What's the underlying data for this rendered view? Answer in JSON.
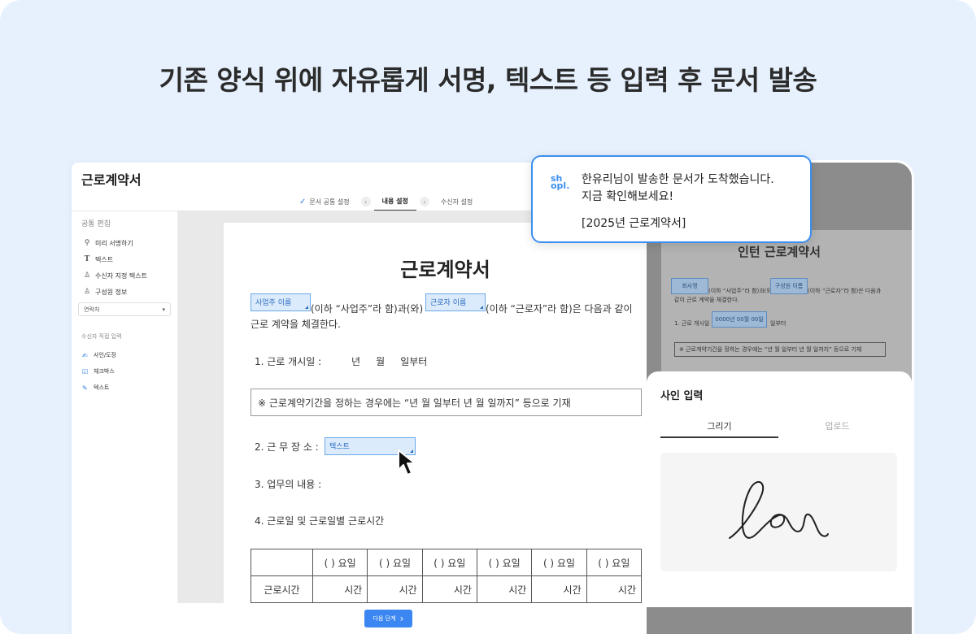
{
  "headline": "기존 양식 위에 자유롭게 서명, 텍스트 등 입력 후 문서 발송",
  "editor": {
    "title": "근로계약서",
    "steps": [
      {
        "label": "문서 공통 설정",
        "state": "done"
      },
      {
        "label": "내용 설정",
        "state": "active"
      },
      {
        "label": "수신자 설정",
        "state": "pending"
      }
    ],
    "sidebar": {
      "common_header": "공통 편집",
      "common_items": [
        {
          "icon": "stamp-icon",
          "label": "미리 서명하기"
        },
        {
          "icon": "text-icon",
          "label": "텍스트"
        },
        {
          "icon": "user-text-icon",
          "label": "수신자 지정 텍스트"
        },
        {
          "icon": "user-icon",
          "label": "구성원 정보"
        }
      ],
      "select_value": "연락처",
      "recipient_header": "수신자 직접 입력",
      "recipient_items": [
        {
          "icon": "sign-stamp-icon",
          "label": "사인/도장"
        },
        {
          "icon": "checkbox-icon",
          "label": "체크박스"
        },
        {
          "icon": "pencil-icon",
          "label": "텍스트"
        }
      ]
    },
    "document": {
      "title": "근로계약서",
      "employer_field": "사업주 이름",
      "employee_field": "근로자 이름",
      "intro_part1": "(이하 “사업주”라 함)과(와)",
      "intro_part2": "(이하 “근로자”라 함)은 다음과 같이",
      "intro_line2": "근로 계약을 체결한다.",
      "start_label": "1. 근로 개시일 :",
      "start_value": "년     월     일부터",
      "note": "※ 근로계약기간을 정하는 경우에는 “년 월 일부터 년 월 일까지” 등으로 기재",
      "workplace_label": "2. 근 무 장 소 :",
      "workplace_field": "텍스트",
      "duty_label": "3. 업무의 내용 :",
      "hours_label": "4. 근로일 및 근로일별 근로시간",
      "table": {
        "day_header": "(    ) 요일",
        "row_label": "근로시간",
        "cell": "시간",
        "columns": 6
      }
    },
    "next_button": "다음 단계"
  },
  "phone": {
    "doc_title": "인턴 근로계약서",
    "field1": "회사명",
    "field2": "구성원 이름",
    "text1": "(이하 “사업주”라 함)과(와)",
    "text2": "(이하 “근로자”라 함)은 다음과",
    "line2": "같이 근로 계약을 체결한다.",
    "start_label": "1. 근로 개시일",
    "date_field": "0000년 00월 00일",
    "start_suffix": "일부터",
    "note": "※ 근로계약기간을 정하는 경우에는 “년 월 일부터 년 월 일까지” 등으로 기재",
    "sheet": {
      "title": "사인 입력",
      "tabs": [
        {
          "label": "그리기",
          "active": true
        },
        {
          "label": "업로드",
          "active": false
        }
      ]
    }
  },
  "notification": {
    "logo_top": "sh",
    "logo_bottom": "opl.",
    "line1": "한유리님이 발송한 문서가 도착했습니다.",
    "line2": "지금 확인해보세요!",
    "doc_name": "[2025년 근로계약서]"
  },
  "colors": {
    "background": "#e6f1fd",
    "accent": "#3b86f0",
    "field_fill": "#dcebfb"
  }
}
